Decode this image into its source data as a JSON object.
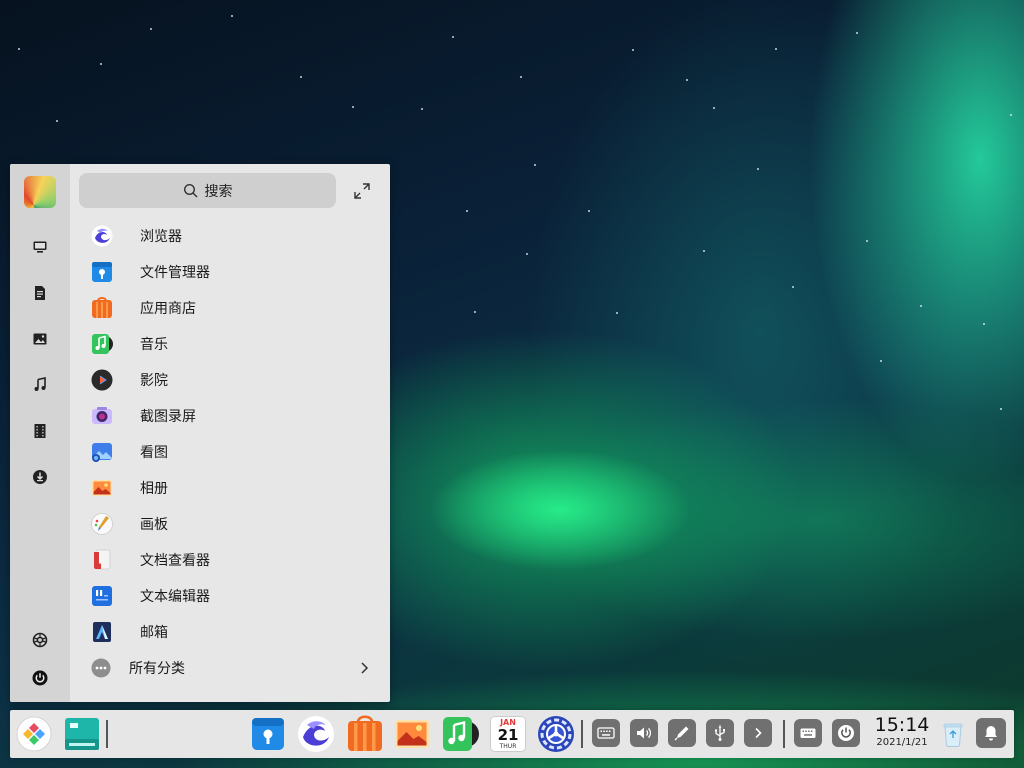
{
  "launcher": {
    "search_placeholder": "搜索",
    "sidebar": {
      "icons": [
        "computer-icon",
        "document-icon",
        "picture-icon",
        "music-icon",
        "video-icon",
        "download-icon"
      ],
      "bottom_icons": [
        "settings-icon",
        "power-icon"
      ]
    },
    "apps": [
      {
        "label": "浏览器",
        "icon": "browser-icon"
      },
      {
        "label": "文件管理器",
        "icon": "file-manager-icon"
      },
      {
        "label": "应用商店",
        "icon": "app-store-icon"
      },
      {
        "label": "音乐",
        "icon": "music-app-icon"
      },
      {
        "label": "影院",
        "icon": "movie-icon"
      },
      {
        "label": "截图录屏",
        "icon": "screenshot-icon"
      },
      {
        "label": "看图",
        "icon": "image-viewer-icon"
      },
      {
        "label": "相册",
        "icon": "album-icon"
      },
      {
        "label": "画板",
        "icon": "drawing-icon"
      },
      {
        "label": "文档查看器",
        "icon": "document-viewer-icon"
      },
      {
        "label": "文本编辑器",
        "icon": "text-editor-icon"
      },
      {
        "label": "邮箱",
        "icon": "mail-icon"
      }
    ],
    "all_categories": "所有分类"
  },
  "taskbar": {
    "calendar": {
      "month": "JAN",
      "day": "21",
      "weekday": "THUR"
    },
    "clock": {
      "time": "15:14",
      "date": "2021/1/21"
    }
  },
  "colors": {
    "launcher_bg": "#e7e7e7",
    "sidebar_bg": "#d4d4d4",
    "taskbar_bg": "#e6e6e6",
    "tray_button": "#707070"
  }
}
